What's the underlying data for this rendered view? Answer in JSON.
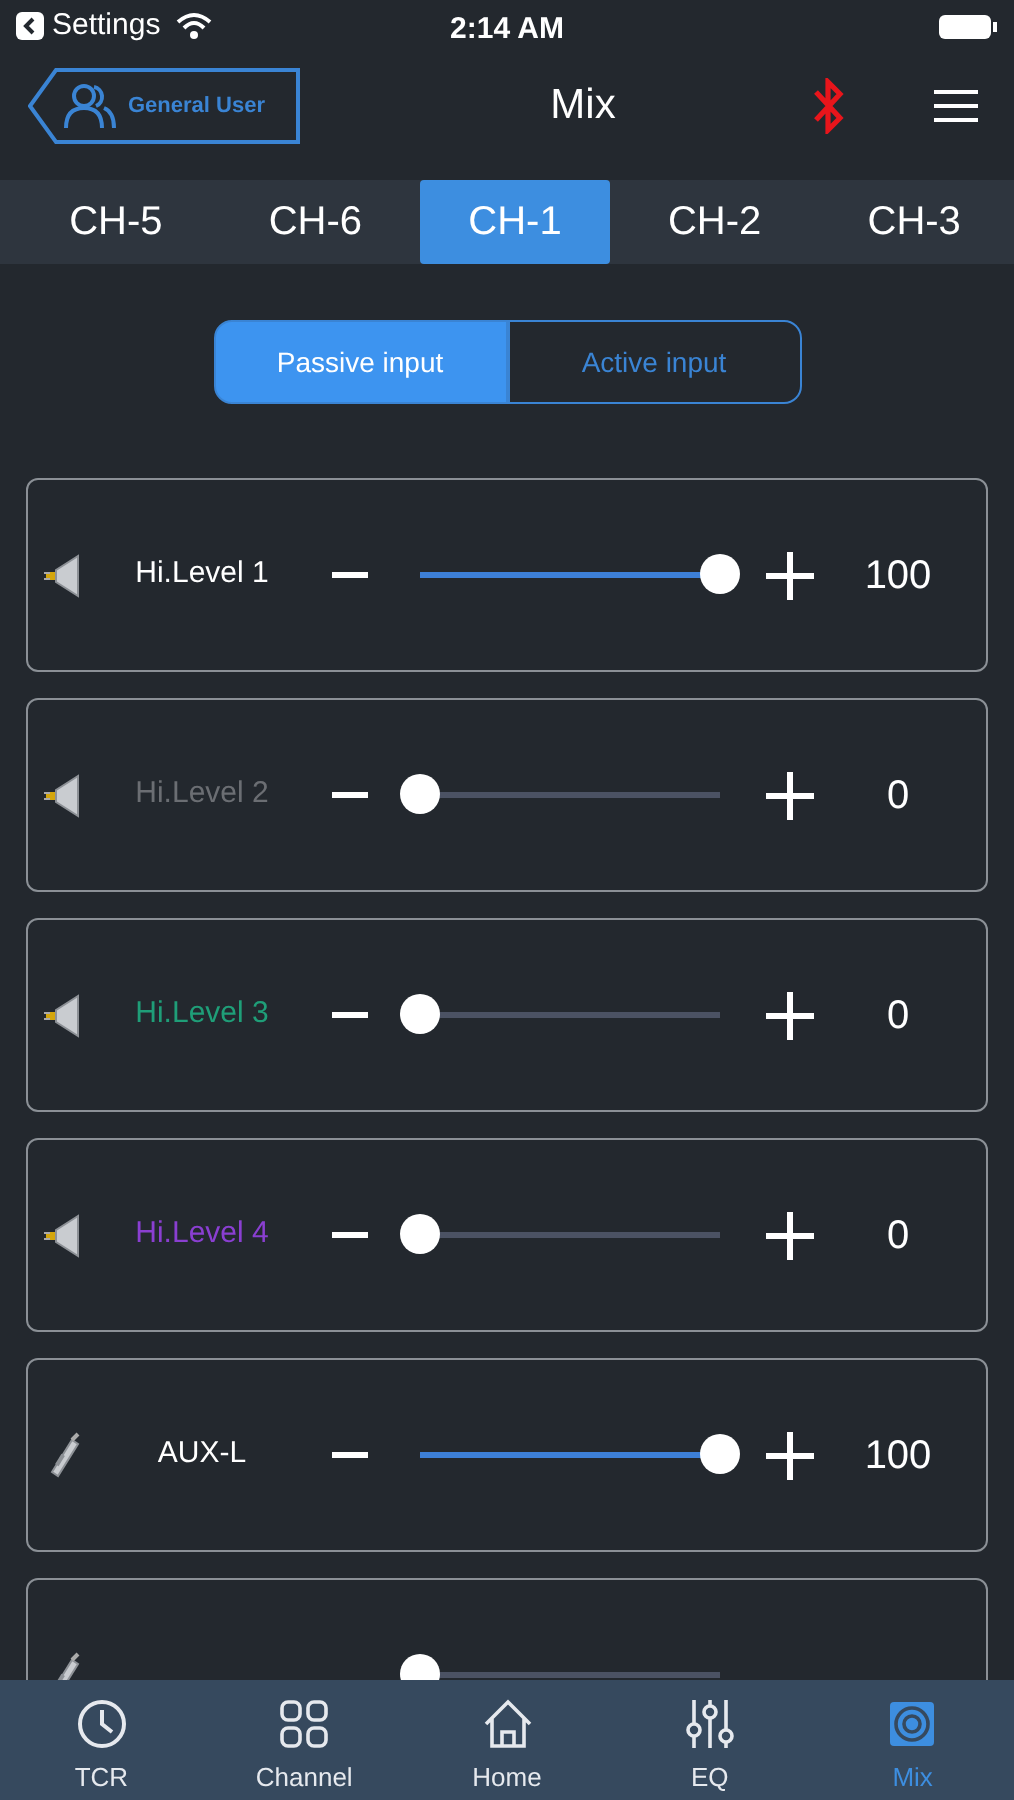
{
  "status_bar": {
    "back_label": "Settings",
    "time": "2:14 AM"
  },
  "header": {
    "user_label": "General User",
    "title": "Mix"
  },
  "channel_tabs": [
    {
      "label": "CH-5",
      "selected": false
    },
    {
      "label": "CH-6",
      "selected": false
    },
    {
      "label": "CH-1",
      "selected": true
    },
    {
      "label": "CH-2",
      "selected": false
    },
    {
      "label": "CH-3",
      "selected": false
    }
  ],
  "input_mode": [
    {
      "label": "Passive input",
      "selected": true
    },
    {
      "label": "Active input",
      "selected": false
    }
  ],
  "channels": [
    {
      "kind": "speaker",
      "name": "Hi.Level 1",
      "color": "#ffffff",
      "level": 1,
      "value": "100"
    },
    {
      "kind": "speaker",
      "name": "Hi.Level 2",
      "color": "#6b6e73",
      "level": 0,
      "value": "0"
    },
    {
      "kind": "speaker",
      "name": "Hi.Level 3",
      "color": "#1f9e78",
      "level": 0,
      "value": "0"
    },
    {
      "kind": "speaker",
      "name": "Hi.Level 4",
      "color": "#8a3fd1",
      "level": 0,
      "value": "0"
    },
    {
      "kind": "aux",
      "name": "AUX-L",
      "color": "#ffffff",
      "level": 1,
      "value": "100"
    },
    {
      "kind": "aux",
      "level": 0
    }
  ],
  "tab_bar": [
    {
      "kind": "clock",
      "label": "TCR",
      "selected": false
    },
    {
      "kind": "grid",
      "label": "Channel",
      "selected": false
    },
    {
      "kind": "home",
      "label": "Home",
      "selected": false
    },
    {
      "kind": "eq",
      "label": "EQ",
      "selected": false
    },
    {
      "kind": "mix",
      "label": "Mix",
      "selected": true
    }
  ]
}
